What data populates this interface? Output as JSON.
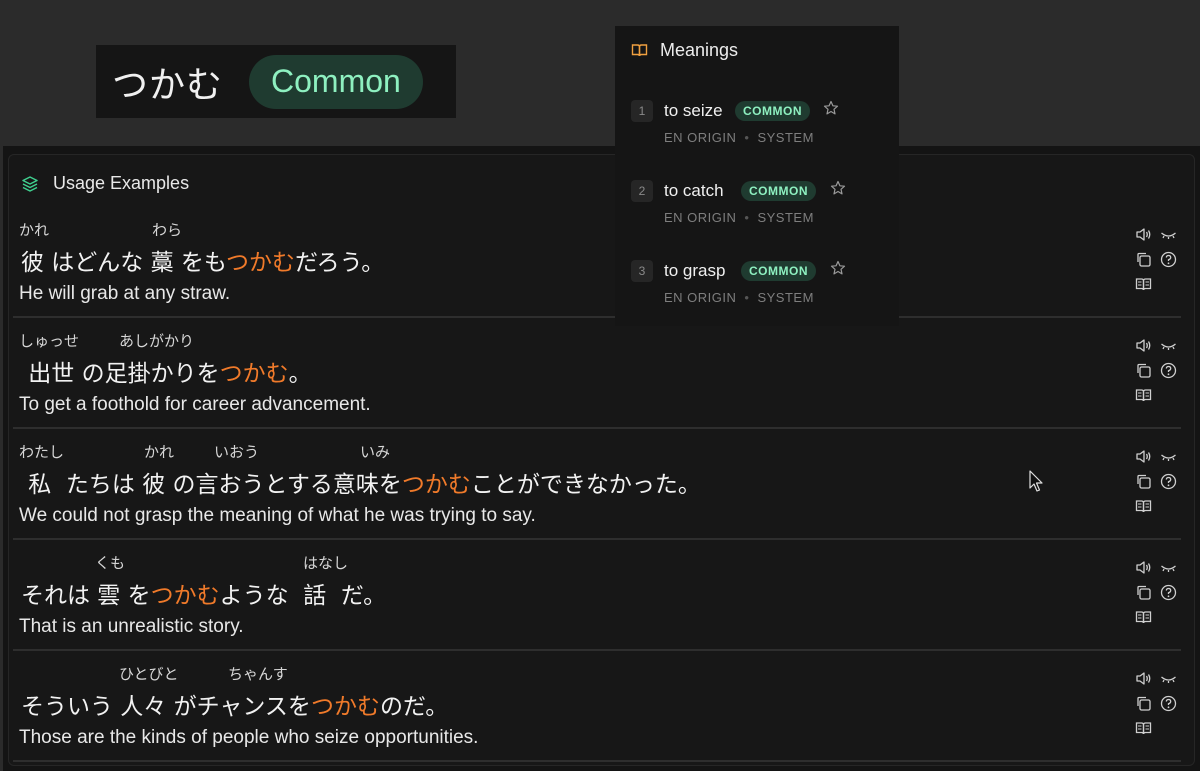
{
  "word_card": {
    "word": "つかむ",
    "badge": "Common"
  },
  "usage": {
    "title": "Usage Examples",
    "examples": [
      {
        "furigana": [
          "かれ",
          "わら"
        ],
        "parts": [
          "彼 はどんな 藁 をも",
          "つかむ",
          "だろう。"
        ],
        "translation": "He will grab at any straw."
      },
      {
        "furigana": [
          "しゅっせ",
          "あしがかり"
        ],
        "parts": [
          " 出世 の足掛かりを",
          "つかむ",
          "。"
        ],
        "translation": "To get a foothold for career advancement."
      },
      {
        "furigana": [
          "わたし",
          "かれ",
          "いおう",
          "いみ"
        ],
        "parts": [
          " 私  たちは 彼 の言おうとする意味を",
          "つかむ",
          "ことができなかった。"
        ],
        "translation": "We could not grasp the meaning of what he was trying to say."
      },
      {
        "furigana": [
          "くも",
          "はなし"
        ],
        "parts": [
          "それは 雲 を",
          "つかむ",
          "ような  話  だ。"
        ],
        "translation": "That is an unrealistic story."
      },
      {
        "furigana": [
          "ひとびと",
          "ちゃんす"
        ],
        "parts": [
          "そういう 人々 がチャンスを",
          "つかむ",
          "のだ。"
        ],
        "translation": "Those are the kinds of people who seize opportunities."
      }
    ],
    "action_icons": [
      "speaker-icon",
      "hide-eye-icon",
      "copy-icon",
      "help-icon",
      "book-icon"
    ]
  },
  "meanings": {
    "title": "Meanings",
    "items": [
      {
        "num": "1",
        "gloss": "to seize",
        "badge": "COMMON",
        "origin": "EN ORIGIN",
        "source": "SYSTEM"
      },
      {
        "num": "2",
        "gloss": "to catch",
        "badge": "COMMON",
        "origin": "EN ORIGIN",
        "source": "SYSTEM"
      },
      {
        "num": "3",
        "gloss": "to grasp",
        "badge": "COMMON",
        "origin": "EN ORIGIN",
        "source": "SYSTEM"
      }
    ]
  },
  "colors": {
    "highlight": "#f07a2a",
    "badge_bg": "#1f3b30",
    "badge_text": "#8ef0c0",
    "meanings_icon": "#f0a040",
    "usage_icon": "#3fcf8e"
  }
}
